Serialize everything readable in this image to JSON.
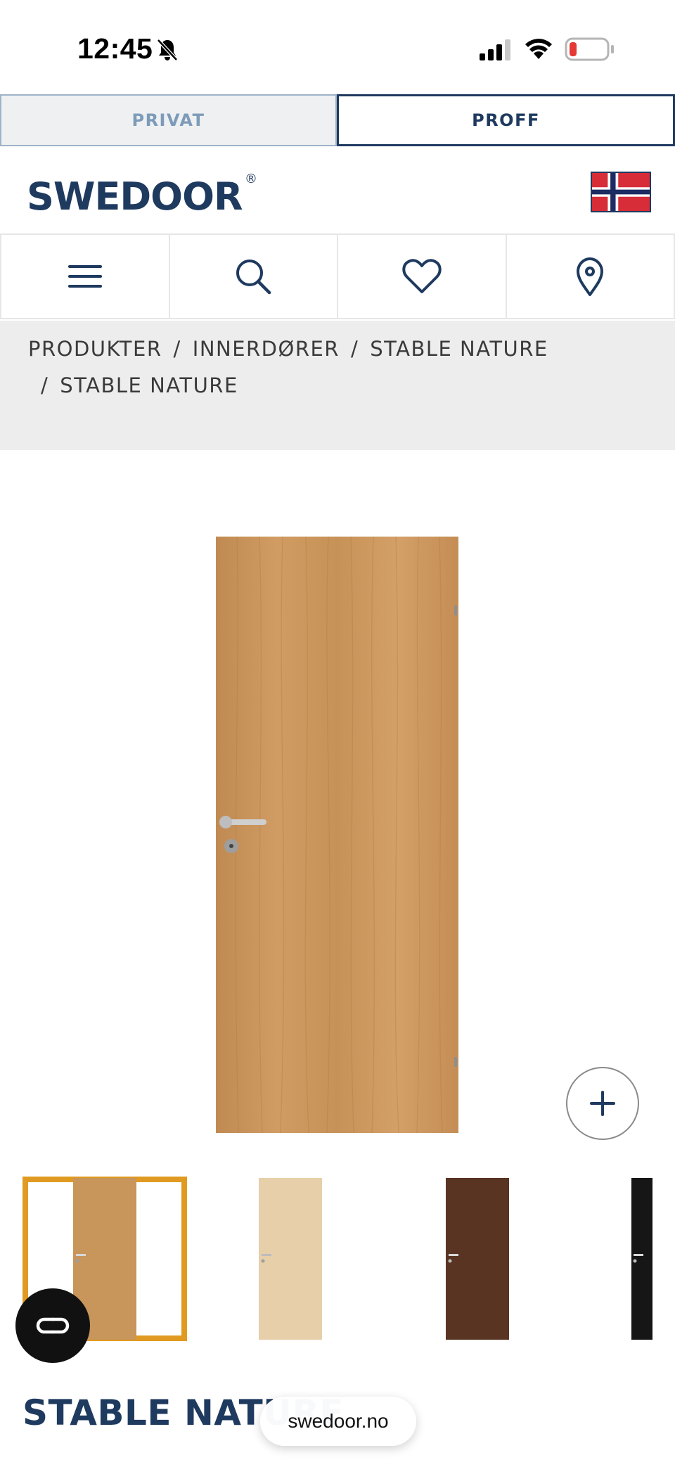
{
  "status_bar": {
    "time": "12:45",
    "icons": [
      "bell-slash-icon",
      "cellular-signal-icon",
      "wifi-icon",
      "battery-low-icon"
    ]
  },
  "segment": {
    "tabs": [
      {
        "label": "PRIVAT",
        "selected": false
      },
      {
        "label": "PROFF",
        "selected": true
      }
    ]
  },
  "header": {
    "logo": "SWEDOOR",
    "logo_mark": "®",
    "flag_icon": "norway-flag-icon"
  },
  "icon_nav": [
    "menu-icon",
    "search-icon",
    "heart-icon",
    "location-pin-icon"
  ],
  "breadcrumb": {
    "items": [
      "PRODUKTER",
      "INNERDØRER",
      "STABLE NATURE",
      "STABLE NATURE"
    ],
    "separator": "/"
  },
  "product": {
    "title": "STABLE NATURE",
    "variants": [
      {
        "name": "oak",
        "color": "#c8955a",
        "selected": true
      },
      {
        "name": "light-ash",
        "color": "#e6cfa9",
        "selected": false
      },
      {
        "name": "walnut",
        "color": "#5a3422",
        "selected": false
      },
      {
        "name": "black",
        "color": "#161616",
        "selected": false
      }
    ]
  },
  "browser": {
    "url": "swedoor.no"
  },
  "colors": {
    "brand": "#1f3a5f",
    "accent": "#e09a21",
    "breadcrumb_bg": "#ededed"
  }
}
